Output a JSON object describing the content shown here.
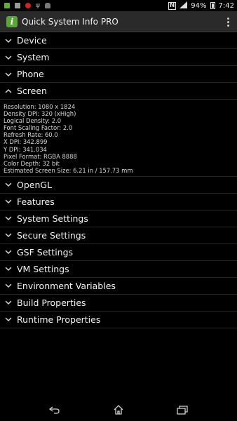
{
  "status_bar": {
    "battery_percent": "94%",
    "time": "7:42",
    "left_icons": [
      "green-app-icon",
      "grey-app-icon",
      "red-app-icon",
      "usb-icon",
      "android-icon"
    ],
    "right_icons": [
      "nfc-icon",
      "signal-icon"
    ]
  },
  "app_bar": {
    "app_icon_letter": "i",
    "title": "Quick System Info PRO"
  },
  "sections": [
    {
      "label": "Device",
      "expanded": false
    },
    {
      "label": "System",
      "expanded": false
    },
    {
      "label": "Phone",
      "expanded": false
    },
    {
      "label": "Screen",
      "expanded": true
    },
    {
      "label": "OpenGL",
      "expanded": false
    },
    {
      "label": "Features",
      "expanded": false
    },
    {
      "label": "System Settings",
      "expanded": false
    },
    {
      "label": "Secure Settings",
      "expanded": false
    },
    {
      "label": "GSF Settings",
      "expanded": false
    },
    {
      "label": "VM Settings",
      "expanded": false
    },
    {
      "label": "Environment Variables",
      "expanded": false
    },
    {
      "label": "Build Properties",
      "expanded": false
    },
    {
      "label": "Runtime Properties",
      "expanded": false
    }
  ],
  "screen_details": [
    "Resolution: 1080 x 1824",
    "Density DPI: 320 (xHigh)",
    "Logical Density: 2.0",
    "Font Scaling Factor: 2.0",
    "Refresh Rate: 60.0",
    "X DPI: 342.899",
    "Y DPI: 341.034",
    "Pixel Format: RGBA 8888",
    "Color Depth: 32 bit",
    "Estimated Screen Size: 6.21 in / 157.73 mm"
  ],
  "colors": {
    "background": "#000000",
    "action_bar": "#2a2a2a",
    "app_icon": "#5ea33a",
    "divider": "#262626"
  },
  "nav_bar": {
    "icons": [
      "back-icon",
      "home-icon",
      "recent-apps-icon"
    ]
  }
}
